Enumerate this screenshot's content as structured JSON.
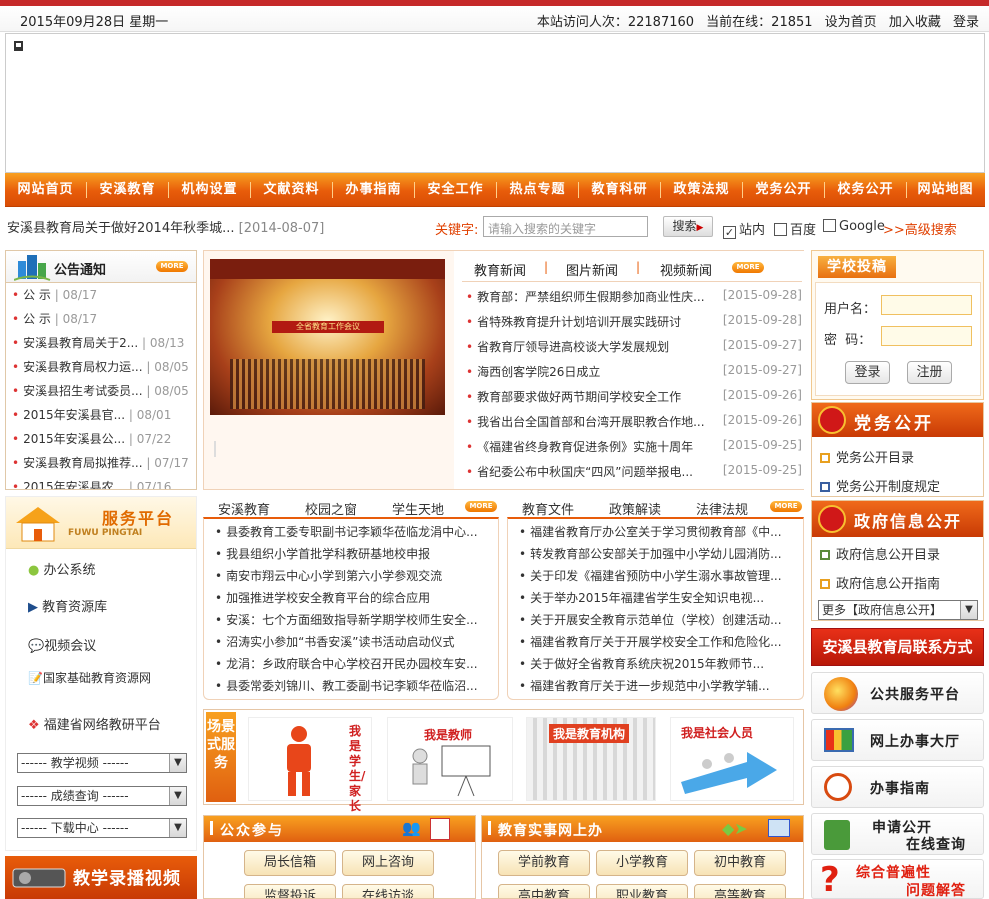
{
  "topbar": {
    "date": "2015年09月28日  星期一",
    "visits_label": "本站访问人次：22187160",
    "online_label": "当前在线：21851",
    "set_home": "设为首页",
    "add_fav": "加入收藏",
    "login": "登录"
  },
  "nav": [
    "网站首页",
    "安溪教育",
    "机构设置",
    "文献资料",
    "办事指南",
    "安全工作",
    "热点专题",
    "教育科研",
    "政策法规",
    "党务公开",
    "校务公开",
    "网站地图"
  ],
  "ticker": {
    "text": "安溪县教育局关于做好2014年秋季城...",
    "date": "[2014-08-07]"
  },
  "search": {
    "keyword_label": "关键字:",
    "placeholder": "请输入搜索的关键字",
    "button": "搜索",
    "opt_site": "站内",
    "opt_baidu": "百度",
    "opt_google": "Google",
    "advanced": ">>高级搜索"
  },
  "notice": {
    "title": "公告通知",
    "more": "MORE",
    "items": [
      {
        "t": "公 示",
        "d": "| 08/17"
      },
      {
        "t": "公 示",
        "d": "| 08/17"
      },
      {
        "t": "安溪县教育局关于2...",
        "d": "| 08/13"
      },
      {
        "t": "安溪县教育局权力运...",
        "d": "| 08/05"
      },
      {
        "t": "安溪县招生考试委员...",
        "d": "| 08/05"
      },
      {
        "t": "2015年安溪县官...",
        "d": "| 08/01"
      },
      {
        "t": "2015年安溪县公...",
        "d": "| 07/22"
      },
      {
        "t": "安溪县教育局拟推荐...",
        "d": "| 07/17"
      },
      {
        "t": "2015年安溪县农...",
        "d": "| 07/16"
      }
    ]
  },
  "service": {
    "title": "服务平台",
    "title_en": "FUWU PINGTAI",
    "items": [
      "办公系统",
      "教育资源库",
      "视频会议",
      "国家基础教育资源网",
      "福建省网络教研平台"
    ],
    "selects": [
      "------ 教学视频 ------",
      "------ 成绩查询 ------",
      "------ 下载中心 ------"
    ]
  },
  "video_banner": "教学录播视频",
  "photo_caption": "全省教育工作会议",
  "news": {
    "tabs": [
      "教育新闻",
      "图片新闻",
      "视频新闻"
    ],
    "more": "MORE",
    "items": [
      {
        "t": "教育部：严禁组织师生假期参加商业性庆...",
        "d": "[2015-09-28]"
      },
      {
        "t": "省特殊教育提升计划培训开展实践研讨",
        "d": "[2015-09-28]"
      },
      {
        "t": "省教育厅领导进高校谈大学发展规划",
        "d": "[2015-09-27]"
      },
      {
        "t": "海西创客学院26日成立",
        "d": "[2015-09-27]"
      },
      {
        "t": "教育部要求做好两节期间学校安全工作",
        "d": "[2015-09-26]"
      },
      {
        "t": "我省出台全国首部和台湾开展职教合作地...",
        "d": "[2015-09-26]"
      },
      {
        "t": "《福建省终身教育促进条例》实施十周年",
        "d": "[2015-09-25]"
      },
      {
        "t": "省纪委公布中秋国庆“四风”问题举报电...",
        "d": "[2015-09-25]"
      }
    ]
  },
  "mid_left": {
    "tabs": [
      "安溪教育",
      "校园之窗",
      "学生天地"
    ],
    "more": "MORE",
    "items": [
      "县委教育工委专职副书记李颖华莅临龙涓中心...",
      "我县组织小学首批学科教研基地校申报",
      "南安市翔云中心小学到第六小学参观交流",
      "加强推进学校安全教育平台的综合应用",
      "安溪：七个方面细致指导新学期学校师生安全...",
      "沼涛实小参加“书香安溪”读书活动启动仪式",
      "龙涓：乡政府联合中心学校召开民办园校车安...",
      "县委常委刘锦川、教工委副书记李颖华莅临沼..."
    ]
  },
  "mid_right": {
    "tabs": [
      "教育文件",
      "政策解读",
      "法律法规"
    ],
    "more": "MORE",
    "items": [
      "福建省教育厅办公室关于学习贯彻教育部《中...",
      "转发教育部公安部关于加强中小学幼儿园消防...",
      "关于印发《福建省预防中小学生溺水事故管理...",
      "关于举办2015年福建省学生安全知识电视...",
      "关于开展安全教育示范单位（学校）创建活动...",
      "福建省教育厅关于开展学校安全工作和危险化...",
      "关于做好全省教育系统庆祝2015年教师节...",
      "福建省教育厅关于进一步规范中小学教学辅..."
    ]
  },
  "scene": {
    "label": "场景式服务",
    "cards": [
      "我是学生/家长",
      "我是教师",
      "我是教育机构",
      "我是社会人员"
    ]
  },
  "public": {
    "title": "公众参与",
    "buttons": [
      "局长信箱",
      "网上咨询",
      "监督投诉",
      "在线访谈"
    ]
  },
  "affairs": {
    "title": "教育实事网上办",
    "buttons": [
      "学前教育",
      "小学教育",
      "初中教育",
      "高中教育",
      "职业教育",
      "高等教育"
    ]
  },
  "login_box": {
    "title": "学校投稿",
    "user_label": "用户名：",
    "pass_label": "密  码：",
    "login": "登录",
    "register": "注册"
  },
  "party": {
    "title": "党务公开",
    "items": [
      "党务公开目录",
      "党务公开制度规定"
    ]
  },
  "gov": {
    "title": "政府信息公开",
    "items": [
      "政府信息公开目录",
      "政府信息公开指南"
    ],
    "select": "更多【政府信息公开】"
  },
  "contact": "安溪县教育局联系方式",
  "right_buttons": [
    "公共服务平台",
    "网上办事大厅",
    "办事指南",
    "申请公开",
    "在线查询",
    "综合普遍性",
    "问题解答"
  ],
  "colors": {
    "accent": "#e85c0a",
    "red": "#c62a2a",
    "link_red": "#e04000"
  }
}
